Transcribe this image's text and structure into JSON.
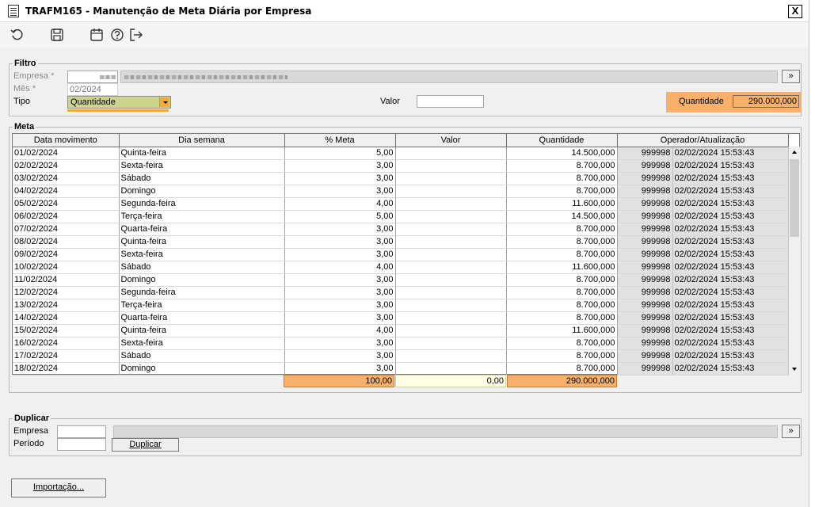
{
  "window": {
    "title": "TRAFM165 - Manutenção de Meta Diária por Empresa",
    "close_label": "X"
  },
  "filtro": {
    "label": "Filtro",
    "empresa_label": "Empresa *",
    "mes_label": "Mês *",
    "mes_value": "02/2024",
    "tipo_label": "Tipo",
    "tipo_value": "Quantidade",
    "valor_label": "Valor",
    "valor_value": "",
    "quantidade_label": "Quantidade",
    "quantidade_value": "290.000,000",
    "lookup_label": "»"
  },
  "meta": {
    "label": "Meta",
    "columns": [
      "Data movimento",
      "Dia semana",
      "% Meta",
      "Valor",
      "Quantidade",
      "Operador/Atualização"
    ],
    "rows": [
      {
        "data": "01/02/2024",
        "dia": "Quinta-feira",
        "pct": "5,00",
        "valor": "",
        "qtd": "14.500,000",
        "op": "999998",
        "upd": "02/02/2024 15:53:43"
      },
      {
        "data": "02/02/2024",
        "dia": "Sexta-feira",
        "pct": "3,00",
        "valor": "",
        "qtd": "8.700,000",
        "op": "999998",
        "upd": "02/02/2024 15:53:43"
      },
      {
        "data": "03/02/2024",
        "dia": "Sábado",
        "pct": "3,00",
        "valor": "",
        "qtd": "8.700,000",
        "op": "999998",
        "upd": "02/02/2024 15:53:43"
      },
      {
        "data": "04/02/2024",
        "dia": "Domingo",
        "pct": "3,00",
        "valor": "",
        "qtd": "8.700,000",
        "op": "999998",
        "upd": "02/02/2024 15:53:43"
      },
      {
        "data": "05/02/2024",
        "dia": "Segunda-feira",
        "pct": "4,00",
        "valor": "",
        "qtd": "11.600,000",
        "op": "999998",
        "upd": "02/02/2024 15:53:43"
      },
      {
        "data": "06/02/2024",
        "dia": "Terça-feira",
        "pct": "5,00",
        "valor": "",
        "qtd": "14.500,000",
        "op": "999998",
        "upd": "02/02/2024 15:53:43"
      },
      {
        "data": "07/02/2024",
        "dia": "Quarta-feira",
        "pct": "3,00",
        "valor": "",
        "qtd": "8.700,000",
        "op": "999998",
        "upd": "02/02/2024 15:53:43"
      },
      {
        "data": "08/02/2024",
        "dia": "Quinta-feira",
        "pct": "3,00",
        "valor": "",
        "qtd": "8.700,000",
        "op": "999998",
        "upd": "02/02/2024 15:53:43"
      },
      {
        "data": "09/02/2024",
        "dia": "Sexta-feira",
        "pct": "3,00",
        "valor": "",
        "qtd": "8.700,000",
        "op": "999998",
        "upd": "02/02/2024 15:53:43"
      },
      {
        "data": "10/02/2024",
        "dia": "Sábado",
        "pct": "4,00",
        "valor": "",
        "qtd": "11.600,000",
        "op": "999998",
        "upd": "02/02/2024 15:53:43"
      },
      {
        "data": "11/02/2024",
        "dia": "Domingo",
        "pct": "3,00",
        "valor": "",
        "qtd": "8.700,000",
        "op": "999998",
        "upd": "02/02/2024 15:53:43"
      },
      {
        "data": "12/02/2024",
        "dia": "Segunda-feira",
        "pct": "3,00",
        "valor": "",
        "qtd": "8.700,000",
        "op": "999998",
        "upd": "02/02/2024 15:53:43"
      },
      {
        "data": "13/02/2024",
        "dia": "Terça-feira",
        "pct": "3,00",
        "valor": "",
        "qtd": "8.700,000",
        "op": "999998",
        "upd": "02/02/2024 15:53:43"
      },
      {
        "data": "14/02/2024",
        "dia": "Quarta-feira",
        "pct": "3,00",
        "valor": "",
        "qtd": "8.700,000",
        "op": "999998",
        "upd": "02/02/2024 15:53:43"
      },
      {
        "data": "15/02/2024",
        "dia": "Quinta-feira",
        "pct": "4,00",
        "valor": "",
        "qtd": "11.600,000",
        "op": "999998",
        "upd": "02/02/2024 15:53:43"
      },
      {
        "data": "16/02/2024",
        "dia": "Sexta-feira",
        "pct": "3,00",
        "valor": "",
        "qtd": "8.700,000",
        "op": "999998",
        "upd": "02/02/2024 15:53:43"
      },
      {
        "data": "17/02/2024",
        "dia": "Sábado",
        "pct": "3,00",
        "valor": "",
        "qtd": "8.700,000",
        "op": "999998",
        "upd": "02/02/2024 15:53:43"
      },
      {
        "data": "18/02/2024",
        "dia": "Domingo",
        "pct": "3,00",
        "valor": "",
        "qtd": "8.700,000",
        "op": "999998",
        "upd": "02/02/2024 15:53:43"
      }
    ],
    "totals": {
      "pct": "100,00",
      "valor": "0,00",
      "qtd": "290.000,000"
    }
  },
  "duplicar": {
    "label": "Duplicar",
    "empresa_label": "Empresa",
    "periodo_label": "Período",
    "button_label": "Duplicar",
    "lookup_label": "»"
  },
  "footer": {
    "importacao_label": "Importação..."
  },
  "colors": {
    "accent_orange": "#f8b06b",
    "select_bg": "#cdd48c",
    "readonly_gray": "#e1e1e1",
    "valor_total_bg": "#ffffe6"
  }
}
